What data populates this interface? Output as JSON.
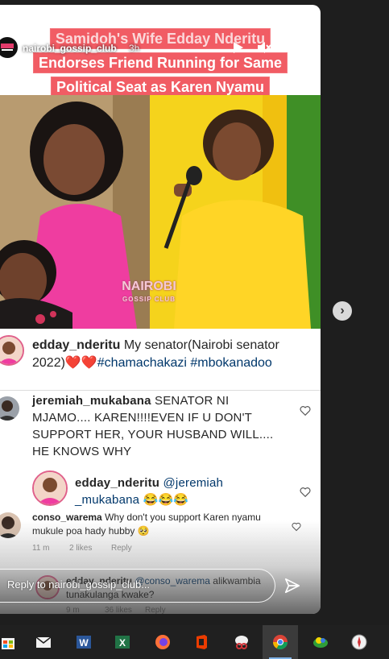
{
  "story": {
    "account": "nairobi_gossip_club",
    "time": "3h",
    "headline": {
      "line1": "Samidoh's Wife Edday Nderitu",
      "line2": "Endorses Friend Running for Same",
      "line3": "Political Seat as Karen Nyamu"
    },
    "watermark": {
      "main": "NAIROBI",
      "sub": "GOSSIP CLUB"
    }
  },
  "caption": {
    "username": "edday_nderitu",
    "text": "My senator(Nairobi senator 2022)",
    "hearts": "❤️❤️",
    "hashtags": [
      "#chamachakazi",
      "#mbokanadoo"
    ]
  },
  "comments": [
    {
      "username": "jeremiah_mukabana",
      "text": "SENATOR NI MJAMO.... KAREN!!!!EVEN IF U DON'T SUPPORT HER, YOUR HUSBAND WILL.... HE KNOWS WHY"
    },
    {
      "username": "edday_nderitu",
      "mention": "@jeremiah _mukabana",
      "emoji": "😂😂😂"
    },
    {
      "username": "conso_warema",
      "text": "Why don't you support Karen nyamu mukule poa hady hubby",
      "emoji": "🥺",
      "time": "11 m",
      "likes": "2 likes",
      "reply": "Reply"
    },
    {
      "username": "edday_nderitu",
      "mention": "@conso_warema",
      "text": "alikwambia tunakulanga kwake?",
      "time": "9 m",
      "likes": "36 likes",
      "reply": "Reply"
    }
  ],
  "reply_box": {
    "placeholder": "Reply to nairobi_gossip_club..."
  },
  "taskbar": {
    "apps": [
      "windows-store",
      "mail",
      "word",
      "excel",
      "firefox",
      "office",
      "snipping-tool",
      "chrome",
      "app-green",
      "app-red"
    ]
  },
  "colors": {
    "headline_bg": "#f15c64",
    "hashtag": "#00376b",
    "taskbar_bg": "#202020"
  }
}
